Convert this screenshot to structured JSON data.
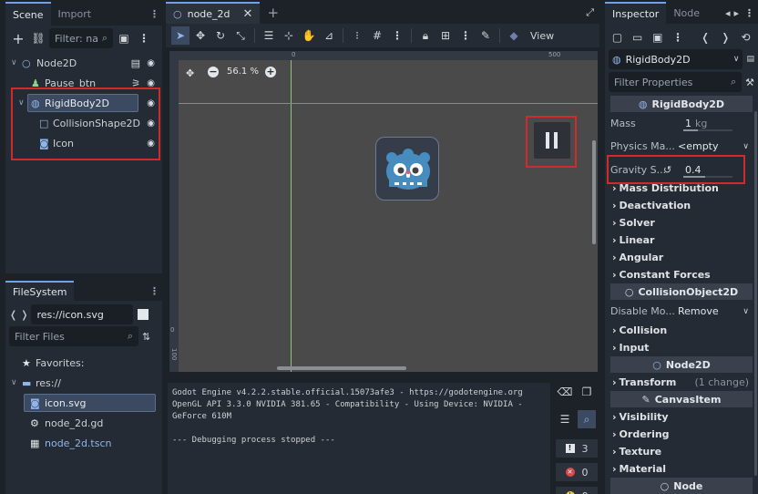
{
  "scene_dock": {
    "tabs": [
      "Scene",
      "Import"
    ],
    "filter_placeholder": "Filter: na",
    "tree": [
      {
        "label": "Node2D",
        "indent": 0
      },
      {
        "label": "Pause_btn",
        "indent": 1
      },
      {
        "label": "RigidBody2D",
        "indent": 1
      },
      {
        "label": "CollisionShape2D",
        "indent": 2
      },
      {
        "label": "Icon",
        "indent": 2
      }
    ]
  },
  "filesystem_dock": {
    "tab": "FileSystem",
    "path": "res://icon.svg",
    "filter_placeholder": "Filter Files",
    "items": [
      {
        "label": "Favorites:"
      },
      {
        "label": "res://"
      },
      {
        "label": "icon.svg"
      },
      {
        "label": "node_2d.gd"
      },
      {
        "label": "node_2d.tscn"
      }
    ]
  },
  "editor": {
    "tab": "node_2d",
    "view_label": "View",
    "zoom": "56.1 %",
    "ruler_labels": [
      "0",
      "500",
      "0",
      "100"
    ]
  },
  "output": {
    "lines": [
      "Godot Engine v4.2.2.stable.official.15073afe3 - https://godotengine.org",
      "OpenGL API 3.3.0 NVIDIA 381.65 - Compatibility - Using Device: NVIDIA -",
      "GeForce 610M",
      "",
      "--- Debugging process stopped ---"
    ],
    "counts": [
      "3",
      "0",
      "0"
    ]
  },
  "inspector": {
    "tabs": [
      "Inspector",
      "Node"
    ],
    "node_name": "RigidBody2D",
    "filter_placeholder": "Filter Properties",
    "header_rigidbody": "RigidBody2D",
    "mass_label": "Mass",
    "mass_value": "1",
    "mass_unit": "kg",
    "physics_label": "Physics Ma...",
    "physics_value": "<empty",
    "gravity_label": "Gravity S...",
    "gravity_value": "0.4",
    "groups1": [
      "Mass Distribution",
      "Deactivation",
      "Solver",
      "Linear",
      "Angular",
      "Constant Forces"
    ],
    "header_collision": "CollisionObject2D",
    "disable_label": "Disable Mo...",
    "disable_value": "Remove",
    "groups2": [
      "Collision",
      "Input"
    ],
    "header_node2d": "Node2D",
    "transform_label": "Transform",
    "transform_note": "(1 change)",
    "header_canvas": "CanvasItem",
    "groups3": [
      "Visibility",
      "Ordering",
      "Texture",
      "Material"
    ],
    "header_node": "Node"
  }
}
